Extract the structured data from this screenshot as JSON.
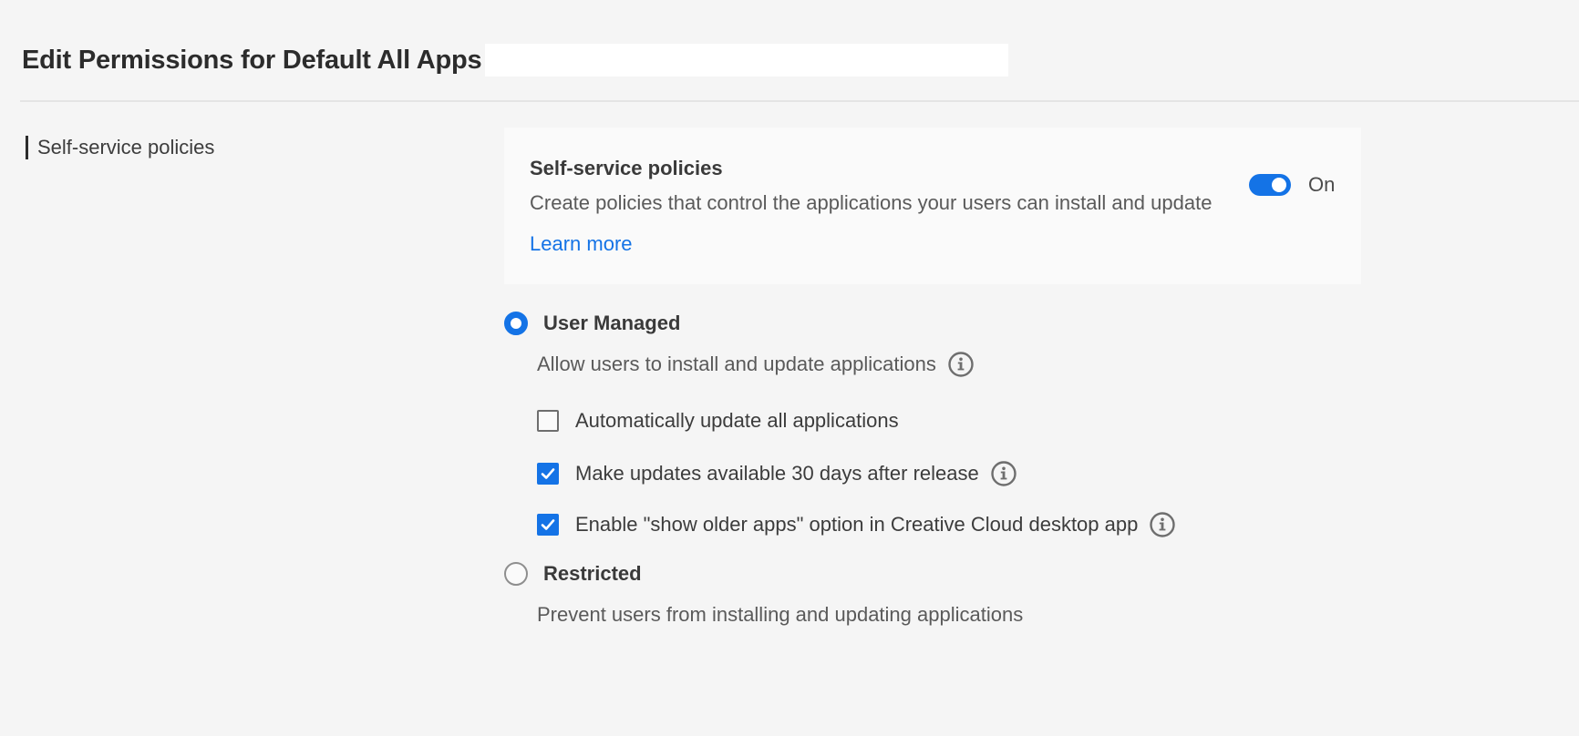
{
  "header": {
    "title": "Edit Permissions for Default All Apps"
  },
  "sidebar": {
    "items": [
      {
        "label": "Self-service policies"
      }
    ]
  },
  "policy_card": {
    "title": "Self-service policies",
    "description": "Create policies that control the applications your users can install and update",
    "learn_more": "Learn more",
    "toggle_label": "On",
    "toggle_on": true
  },
  "options": {
    "user_managed": {
      "label": "User Managed",
      "description": "Allow users to install and update applications",
      "selected": true
    },
    "checkboxes": [
      {
        "label": "Automatically update all applications",
        "checked": false
      },
      {
        "label": "Make updates available 30 days after release",
        "checked": true
      },
      {
        "label": "Enable \"show older apps\" option in Creative Cloud desktop app",
        "checked": true
      }
    ],
    "restricted": {
      "label": "Restricted",
      "description": "Prevent users from installing and updating applications",
      "selected": false
    }
  },
  "colors": {
    "accent": "#1473e6",
    "background": "#f5f5f5",
    "card": "#fafafa"
  },
  "icons": {
    "info": "info-circle-icon",
    "checkmark": "checkmark-icon"
  }
}
